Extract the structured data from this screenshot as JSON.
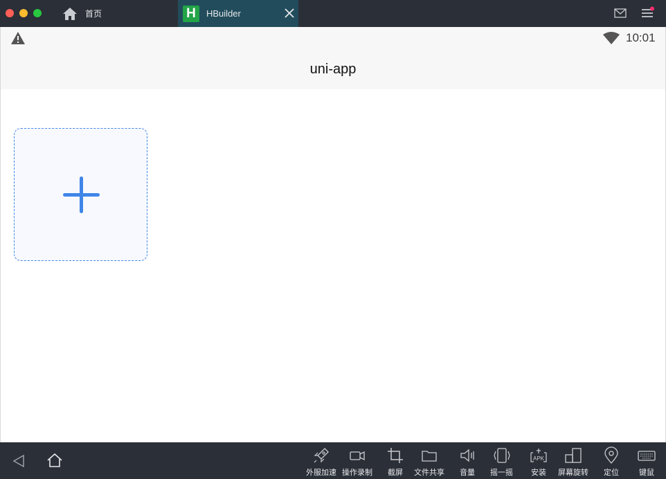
{
  "titlebar": {
    "tabs": [
      {
        "label": "首页",
        "icon": "home-icon"
      },
      {
        "label": "HBuilder",
        "icon": "hbuilder-logo",
        "logo_letter": "H"
      }
    ],
    "icons": [
      "mail-icon",
      "menu-icon"
    ]
  },
  "statusbar": {
    "time": "10:01",
    "icons": [
      "warning-icon",
      "wifi-icon"
    ]
  },
  "app": {
    "title": "uni-app",
    "upload_icon": "plus-icon"
  },
  "toolbar": {
    "nav_icons": [
      "back-triangle-icon",
      "home-outline-icon"
    ],
    "items": [
      {
        "label": "外服加速",
        "icon": "rocket-icon"
      },
      {
        "label": "操作录制",
        "icon": "video-icon"
      },
      {
        "label": "截屏",
        "icon": "crop-icon"
      },
      {
        "label": "文件共享",
        "icon": "folder-icon"
      },
      {
        "label": "音量",
        "icon": "volume-icon"
      },
      {
        "label": "摇一摇",
        "icon": "shake-icon"
      },
      {
        "label": "安装",
        "icon": "apk-icon",
        "icon_text": "APK"
      },
      {
        "label": "屏幕旋转",
        "icon": "rotate-screen-icon"
      },
      {
        "label": "定位",
        "icon": "location-pin-icon"
      },
      {
        "label": "键鼠",
        "icon": "keyboard-icon"
      }
    ]
  },
  "colors": {
    "chrome": "#2b2f37",
    "active_tab": "#224c5c",
    "accent": "#3f86e8",
    "hbuilder_green": "#22a447",
    "statusbar_bg": "#f7f7f7"
  }
}
